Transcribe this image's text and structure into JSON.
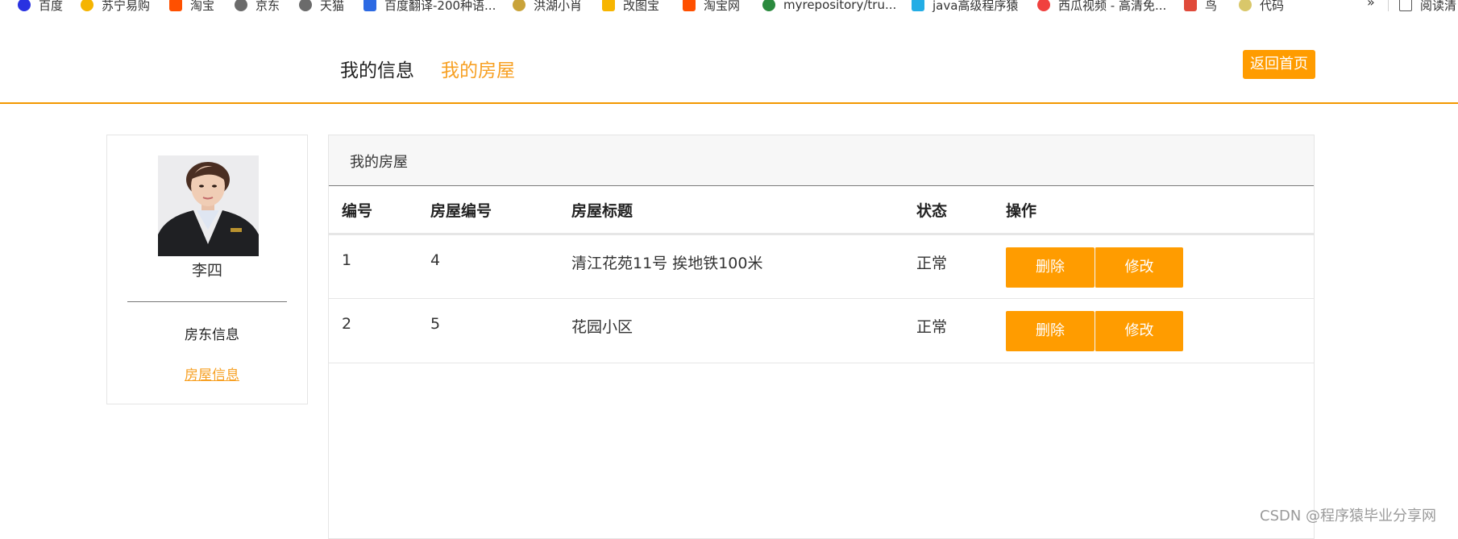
{
  "bookmarks": {
    "items": [
      {
        "label": "百度",
        "icon": "baidu-icon",
        "color": "#2932e1"
      },
      {
        "label": "苏宁易购",
        "icon": "suning-icon",
        "color": "#f5b400"
      },
      {
        "label": "淘宝",
        "icon": "taobao-icon",
        "color": "#ff5000"
      },
      {
        "label": "京东",
        "icon": "globe-icon",
        "color": "#6b6b6b"
      },
      {
        "label": "天猫",
        "icon": "globe-icon",
        "color": "#6b6b6b"
      },
      {
        "label": "百度翻译-200种语...",
        "icon": "translate-icon",
        "color": "#2d6ae3"
      },
      {
        "label": "洪湖小肖",
        "icon": "bee-icon",
        "color": "#c9a33a"
      },
      {
        "label": "改图宝",
        "icon": "gaitubao-icon",
        "color": "#f7b500"
      },
      {
        "label": "淘宝网",
        "icon": "taobao-icon",
        "color": "#ff5000"
      },
      {
        "label": "myrepository/tru...",
        "icon": "chrome-icon",
        "color": "#2b8a3e"
      },
      {
        "label": "java高级程序猿",
        "icon": "bilibili-icon",
        "color": "#23ade5"
      },
      {
        "label": "西瓜视频 - 高清免...",
        "icon": "xigua-icon",
        "color": "#f0413f"
      },
      {
        "label": "鸟",
        "icon": "bird-icon",
        "color": "#e04a3a"
      },
      {
        "label": "代码",
        "icon": "code-icon",
        "color": "#d9c76a"
      }
    ],
    "more": "»",
    "reading": "阅读清"
  },
  "header": {
    "nav_info": "我的信息",
    "nav_house": "我的房屋",
    "home_button": "返回首页"
  },
  "profile": {
    "name": "李四",
    "link_landlord": "房东信息",
    "link_house": "房屋信息"
  },
  "panel": {
    "title": "我的房屋",
    "columns": [
      "编号",
      "房屋编号",
      "房屋标题",
      "状态",
      "操作"
    ],
    "rows": [
      {
        "id": "1",
        "house_id": "4",
        "title": "清江花苑11号 挨地铁100米",
        "status": "正常",
        "delete": "删除",
        "edit": "修改"
      },
      {
        "id": "2",
        "house_id": "5",
        "title": "花园小区",
        "status": "正常",
        "delete": "删除",
        "edit": "修改"
      }
    ]
  },
  "watermark": "CSDN @程序猿毕业分享网",
  "colors": {
    "accent": "#ff9c00",
    "accent_text": "#f7a023"
  }
}
